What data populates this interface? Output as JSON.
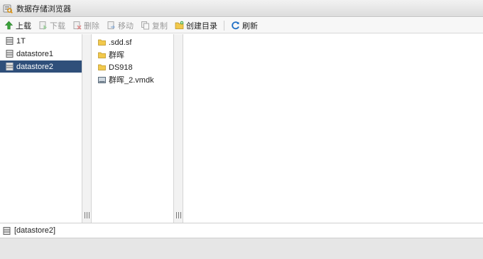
{
  "window": {
    "title": "数据存储浏览器",
    "app_icon": "datastore-browser-icon"
  },
  "toolbar": {
    "buttons": [
      {
        "label": "上载",
        "icon": "upload-icon",
        "enabled": true
      },
      {
        "label": "下载",
        "icon": "download-icon",
        "enabled": false
      },
      {
        "label": "删除",
        "icon": "delete-icon",
        "enabled": false
      },
      {
        "label": "移动",
        "icon": "move-icon",
        "enabled": false
      },
      {
        "label": "复制",
        "icon": "copy-icon",
        "enabled": false
      },
      {
        "label": "创建目录",
        "icon": "new-folder-icon",
        "enabled": true
      },
      {
        "label": "刷新",
        "icon": "refresh-icon",
        "enabled": true
      }
    ]
  },
  "datastores": [
    {
      "label": "1T",
      "selected": false
    },
    {
      "label": "datastore1",
      "selected": false
    },
    {
      "label": "datastore2",
      "selected": true
    }
  ],
  "files": [
    {
      "label": ".sdd.sf",
      "type": "folder"
    },
    {
      "label": "群晖",
      "type": "folder"
    },
    {
      "label": "DS918",
      "type": "folder"
    },
    {
      "label": "群晖_2.vmdk",
      "type": "disk"
    }
  ],
  "status": {
    "path": "[datastore2]"
  },
  "colors": {
    "selection": "#2f4f7a",
    "folder": "#f2c94c",
    "accent_green": "#3aa33a",
    "accent_blue": "#1f6fc5"
  }
}
